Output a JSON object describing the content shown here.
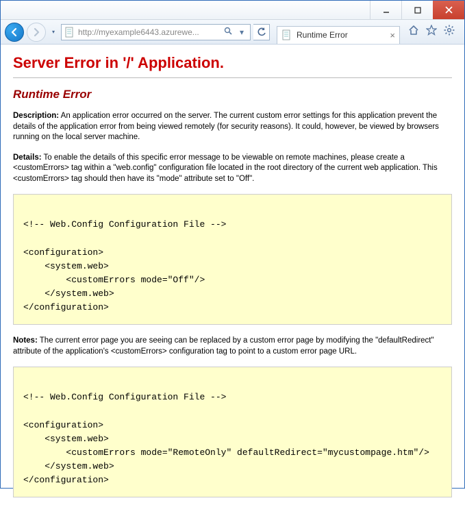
{
  "window": {
    "url_display": "http://myexample6443.azurewe...",
    "tab_title": "Runtime Error"
  },
  "page": {
    "h1": "Server Error in '/' Application.",
    "h2": "Runtime Error",
    "desc_label": "Description:",
    "desc_text": " An application error occurred on the server. The current custom error settings for this application prevent the details of the application error from being viewed remotely (for security reasons). It could, however, be viewed by browsers running on the local server machine.",
    "details_label": "Details:",
    "details_text": " To enable the details of this specific error message to be viewable on remote machines, please create a <customErrors> tag within a \"web.config\" configuration file located in the root directory of the current web application. This <customErrors> tag should then have its \"mode\" attribute set to \"Off\".",
    "code1": "\n<!-- Web.Config Configuration File -->\n\n<configuration>\n    <system.web>\n        <customErrors mode=\"Off\"/>\n    </system.web>\n</configuration>",
    "notes_label": "Notes:",
    "notes_text": " The current error page you are seeing can be replaced by a custom error page by modifying the \"defaultRedirect\" attribute of the application's <customErrors> configuration tag to point to a custom error page URL.",
    "code2": "\n<!-- Web.Config Configuration File -->\n\n<configuration>\n    <system.web>\n        <customErrors mode=\"RemoteOnly\" defaultRedirect=\"mycustompage.htm\"/>\n    </system.web>\n</configuration>"
  }
}
